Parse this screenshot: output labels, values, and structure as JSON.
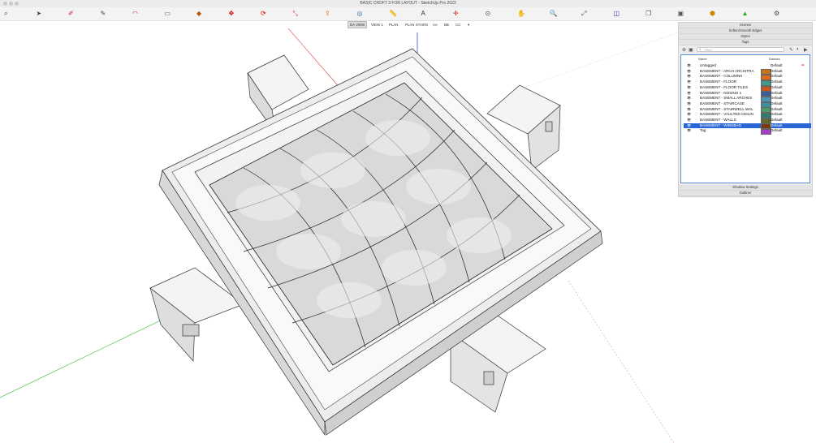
{
  "window": {
    "title": "BASIC CROFT 3 FOR LAYOUT - SketchUp Pro 2023"
  },
  "toolbar": {
    "icons": [
      "search-icon",
      "select-icon",
      "eraser-icon",
      "pencil-icon",
      "arc-icon",
      "rectangle-icon",
      "paint-icon",
      "move-icon",
      "rotate-icon",
      "scale-icon",
      "pushpull-icon",
      "offset-icon",
      "tape-icon",
      "text-icon",
      "axes-icon",
      "orbit-icon",
      "pan-icon",
      "zoom-icon",
      "zoom-extents-icon",
      "section-icon",
      "component-icon",
      "group-icon",
      "solid-icon",
      "sandbox-icon",
      "gear-icon"
    ]
  },
  "scene_tabs": [
    "DA VIEW",
    "VIEW 1",
    "PLAN",
    "PLAN STAIRS",
    "AA",
    "BB",
    "CC"
  ],
  "active_tab": "DA VIEW",
  "tray": {
    "sections": {
      "scenes": "Scenes",
      "softsmooth": "Soften/Smooth Edges",
      "styles": "Styles",
      "tags": "Tags",
      "shadow": "Shadow Settings",
      "outliner": "Outliner"
    },
    "search_placeholder": "Filter",
    "columns": {
      "name": "Name",
      "dashes": "Dashes"
    },
    "tags": [
      {
        "name": "Untagged",
        "dashes": "Default",
        "color": "#ffffff"
      },
      {
        "name": "BASEMENT - ARCH ARCHITRA",
        "dashes": "Default",
        "color": "#c8731c"
      },
      {
        "name": "BASEMENT - COLUMNS",
        "dashes": "Default",
        "color": "#d96b1b"
      },
      {
        "name": "BASEMENT - FLOOR",
        "dashes": "Default",
        "color": "#3e9a8c"
      },
      {
        "name": "BASEMENT - FLOOR TILES",
        "dashes": "Default",
        "color": "#c7561e"
      },
      {
        "name": "BASEMENT - NOSING 1",
        "dashes": "Default",
        "color": "#3b5e9b"
      },
      {
        "name": "BASEMENT - SMALL ARCHES",
        "dashes": "Default",
        "color": "#4c93b8"
      },
      {
        "name": "BASEMENT - STAIRCASE",
        "dashes": "Default",
        "color": "#3d8ea0"
      },
      {
        "name": "BASEMENT - STAIRWELL WAL",
        "dashes": "Default",
        "color": "#4e9a6b"
      },
      {
        "name": "BASEMENT - VAULTED CEILIN",
        "dashes": "Default",
        "color": "#2f7b74"
      },
      {
        "name": "BASEMENT - WALLS",
        "dashes": "Default",
        "color": "#5b6b2d"
      },
      {
        "name": "BASEMENT - WINDBAG",
        "dashes": "Default",
        "color": "#7a3a12"
      },
      {
        "name": "Tag",
        "dashes": "Default",
        "color": "#a63fc7"
      }
    ],
    "selected_tag": "BASEMENT - WINDBAG"
  }
}
